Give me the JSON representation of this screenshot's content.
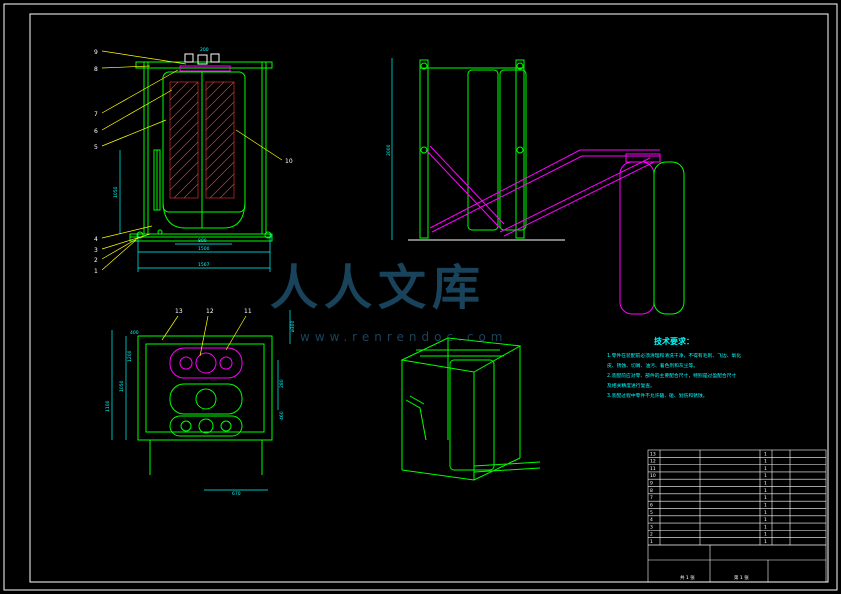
{
  "drawing": {
    "colors": {
      "background": "#000000",
      "frame": "#ffffff",
      "structure": "#00ff00",
      "members": "#ff00ff",
      "dimension": "#00ffff",
      "leader": "#ffff00",
      "hatch": "#ff3333",
      "watermark": "#2f7aa6"
    },
    "front_view": {
      "part_labels": [
        "9",
        "8",
        "7",
        "6",
        "5",
        "4",
        "3",
        "2",
        "1",
        "10"
      ],
      "dims": [
        "200",
        "1050",
        "800",
        "1500",
        "1567"
      ]
    },
    "side_view": {
      "dims": [
        "2000"
      ]
    },
    "top_view": {
      "part_labels": [
        "13",
        "12",
        "11"
      ],
      "dims": [
        "1100",
        "1050",
        "1200",
        "280",
        "460",
        "670",
        "ø300",
        "400"
      ]
    },
    "watermark": {
      "text": "人人文库",
      "url": "www.renrendoc.com"
    },
    "notes": {
      "title": "技术要求：",
      "lines": [
        "1.零件在装配前必须清理和清洗干净，不得有毛刺、飞边、氧化",
        "皮、锈蚀、切屑、油污、着色剂和灰尘等。",
        "2.装配前应对零、部件的主要配合尺寸，特别是过盈配合尺寸",
        "及相关精度进行复查。",
        "3.装配过程中零件不允许磕、碰、划伤和锈蚀。"
      ]
    },
    "title_block": {
      "rows": [
        [
          "13",
          "",
          "",
          "1",
          ""
        ],
        [
          "12",
          "",
          "",
          "1",
          ""
        ],
        [
          "11",
          "",
          "",
          "1",
          ""
        ],
        [
          "10",
          "",
          "",
          "1",
          ""
        ],
        [
          "9",
          "",
          "",
          "1",
          ""
        ],
        [
          "8",
          "",
          "",
          "1",
          ""
        ],
        [
          "7",
          "",
          "",
          "1",
          ""
        ],
        [
          "6",
          "",
          "",
          "1",
          ""
        ],
        [
          "5",
          "",
          "",
          "1",
          ""
        ],
        [
          "4",
          "",
          "",
          "1",
          ""
        ],
        [
          "3",
          "",
          "",
          "1",
          ""
        ],
        [
          "2",
          "",
          "",
          "1",
          ""
        ],
        [
          "1",
          "",
          "",
          "1",
          ""
        ]
      ],
      "footer": [
        "共 1 张",
        "第 1 张"
      ]
    }
  }
}
